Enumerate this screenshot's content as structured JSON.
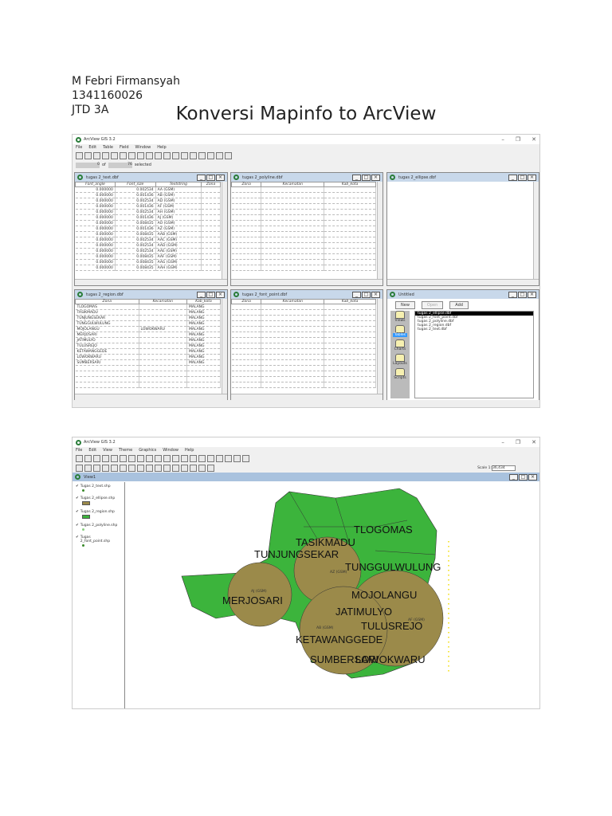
{
  "header": {
    "author": "M Febri Firmansyah",
    "nim": "1341160026",
    "class": "JTD 3A",
    "title": "Konversi Mapinfo to ArcView"
  },
  "shot1": {
    "app_title": "ArcView GIS 3.2",
    "menu": [
      "File",
      "Edit",
      "Table",
      "Field",
      "Window",
      "Help"
    ],
    "selection": {
      "selected": "0",
      "total": "76",
      "of_label": "of",
      "selected_label": "selected"
    },
    "text_table": {
      "title": "tugas 2_text.dbf",
      "columns": [
        "Font_angle",
        "Font_size",
        "Textstring",
        "Zona"
      ],
      "rows": [
        [
          "0.000000",
          "0.002534",
          "AA (GSM)",
          ""
        ],
        [
          "0.000000",
          "0.001436",
          "AB (GSM)",
          ""
        ],
        [
          "0.000000",
          "0.002534",
          "AD (GSM)",
          ""
        ],
        [
          "0.000000",
          "0.001436",
          "AF (GSM)",
          ""
        ],
        [
          "0.000000",
          "0.002534",
          "AH (GSM)",
          ""
        ],
        [
          "0.000000",
          "0.001436",
          "AJ (GSM)",
          ""
        ],
        [
          "0.000000",
          "0.008435",
          "AO (GSM)",
          ""
        ],
        [
          "0.000000",
          "0.001436",
          "AZ (GSM)",
          ""
        ],
        [
          "0.000000",
          "0.008435",
          "AAB (GSM)",
          ""
        ],
        [
          "0.000000",
          "0.002534",
          "AAC (GSM)",
          ""
        ],
        [
          "0.000000",
          "0.002534",
          "AAD (GSM)",
          ""
        ],
        [
          "0.000000",
          "0.002534",
          "AAE (GSM)",
          ""
        ],
        [
          "0.000000",
          "0.008435",
          "AAF (GSM)",
          ""
        ],
        [
          "0.000000",
          "0.008435",
          "AAG (GSM)",
          ""
        ],
        [
          "0.000000",
          "0.008435",
          "AAH (GSM)",
          ""
        ]
      ]
    },
    "polyline_table": {
      "title": "tugas 2_polyline.dbf",
      "columns": [
        "Zona",
        "Kecamatan",
        "Kab_kota"
      ]
    },
    "ellipse_table": {
      "title": "tugas 2_ellipse.dbf"
    },
    "region_table": {
      "title": "tugas 2_region.dbf",
      "columns": [
        "Zona",
        "Kecamatan",
        "Kab_kota"
      ],
      "rows": [
        [
          "TLOGOMAS",
          "",
          "MALANG"
        ],
        [
          "TASIKMADU",
          "",
          "MALANG"
        ],
        [
          "TUNJUNGSEKAR",
          "",
          "MALANG"
        ],
        [
          "TUNGGULWULUNG",
          "",
          "MALANG"
        ],
        [
          "MOJOLANGU",
          "LOWOKWARU",
          "MALANG"
        ],
        [
          "MERJOSARI",
          "",
          "MALANG"
        ],
        [
          "JATIMULYO",
          "",
          "MALANG"
        ],
        [
          "TULUSREJO",
          "",
          "MALANG"
        ],
        [
          "KETAWANGGEDE",
          "",
          "MALANG"
        ],
        [
          "LOWOKWARU",
          "",
          "MALANG"
        ],
        [
          "SUMBERSARI",
          "",
          "MALANG"
        ]
      ]
    },
    "fontpoint_table": {
      "title": "tugas 2_font_point.dbf",
      "columns": [
        "Zona",
        "Kecamatan",
        "Kab_kota"
      ]
    },
    "project": {
      "title": "Untitled",
      "buttons": [
        "New",
        "Open",
        "Add"
      ],
      "categories": [
        "Views",
        "Tables",
        "Charts",
        "Layouts",
        "Scripts"
      ],
      "selected_category": "Tables",
      "files": [
        "tugas 2_ellipse.dbf",
        "tugas 2_font_point.dbf",
        "tugas 2_polyline.dbf",
        "tugas 2_region.dbf",
        "tugas 2_text.dbf"
      ]
    }
  },
  "shot2": {
    "app_title": "ArcView GIS 3.2",
    "menu": [
      "File",
      "Edit",
      "View",
      "Theme",
      "Graphics",
      "Window",
      "Help"
    ],
    "scale_label": "Scale 1:",
    "scale_value": "36,434",
    "view_title": "View1",
    "themes": [
      {
        "name": "Tugas 2_text.shp",
        "color": "#3a8a2a"
      },
      {
        "name": "Tugas 2_ellipse.shp",
        "color": "#9b8a4a"
      },
      {
        "name": "Tugas 2_region.shp",
        "color": "#3cb43c"
      },
      {
        "name": "Tugas 2_polyline.shp",
        "color": "#8ad080"
      },
      {
        "name": "Tugas 2_font_point.shp",
        "color": "#3a8a2a"
      }
    ],
    "map_labels": [
      "TLOGOMAS",
      "TASIKMADU",
      "TUNJUNGSEKAR",
      "TUNGGULWULUNG",
      "MERJOSARI",
      "MOJOLANGU",
      "JATIMULYO",
      "TULUSREJO",
      "KETAWANGGEDE",
      "SUMBERSARI",
      "LOWOKWARU"
    ],
    "circle_labels": [
      "AZ (GSM)",
      "AJ (GSM)",
      "AB (GSM)",
      "AF (GSM)"
    ],
    "colors": {
      "region": "#3cb43c",
      "ellipse": "#9b8a4a",
      "points": "#f5e642"
    }
  }
}
